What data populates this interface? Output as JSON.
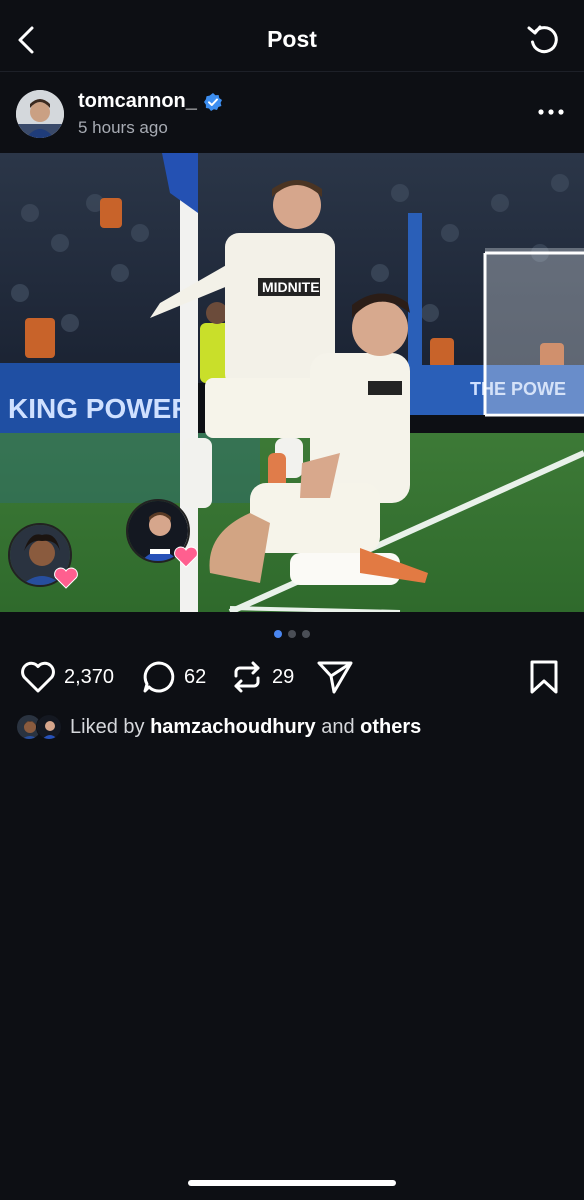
{
  "header": {
    "title": "Post",
    "back_icon": "chevron-left-icon",
    "refresh_icon": "refresh-icon"
  },
  "post": {
    "username": "tomcannon_",
    "verified": true,
    "time": "5 hours ago",
    "more_icon": "more-horizontal-icon",
    "media": {
      "description_icon": "photo",
      "sponsor": "MIDNITE",
      "board_left": "KING POWER",
      "board_right": "THE POWE",
      "carousel_index": 1,
      "carousel_total": 3
    },
    "reactions": [
      {
        "name": "reactor-1",
        "heart_color": "#ff5f8f"
      },
      {
        "name": "reactor-2",
        "heart_color": "#ff5f8f"
      }
    ]
  },
  "actions": {
    "likes": "2,370",
    "comments": "62",
    "reposts": "29"
  },
  "liked_by": {
    "prefix": "Liked by ",
    "user": "hamzachoudhury",
    "middle": " and ",
    "others": "others"
  },
  "colors": {
    "background": "#0d0f14",
    "accent": "#4a86f0",
    "verified": "#3d8ef0"
  }
}
